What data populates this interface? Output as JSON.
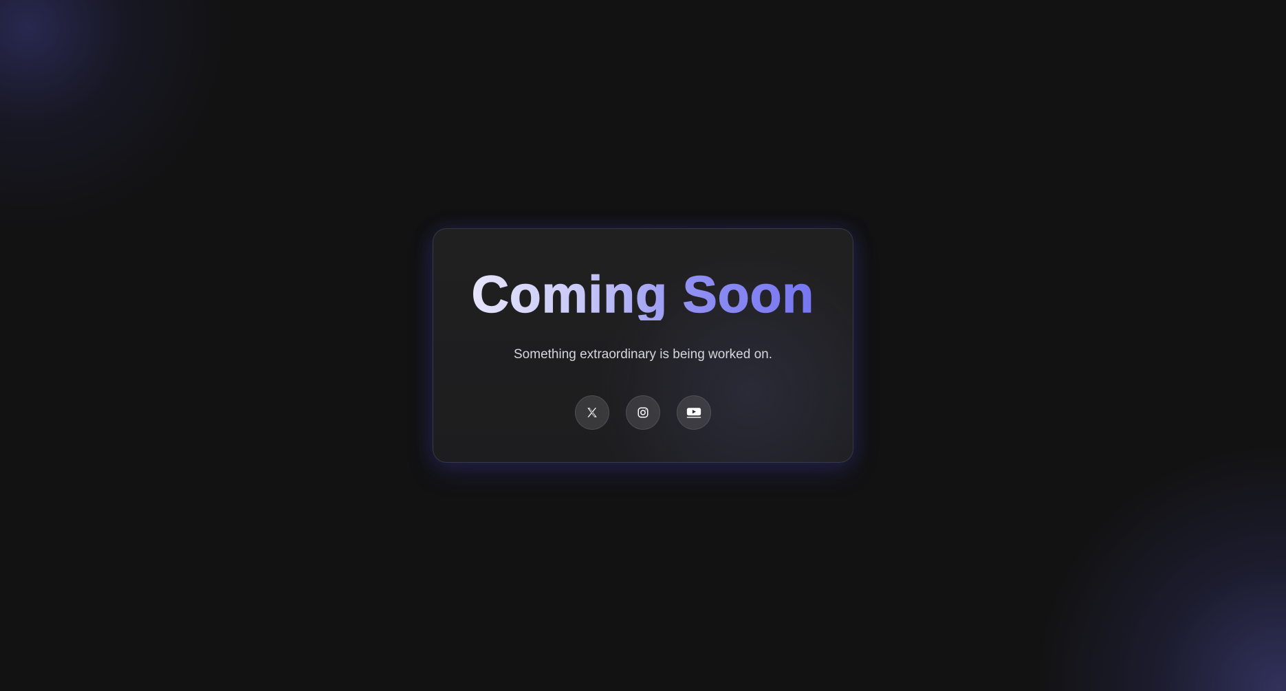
{
  "hero": {
    "title_part1": "Coming",
    "title_part2": "Soon",
    "subtitle": "Something extraordinary is being worked on."
  },
  "socials": [
    {
      "name": "x-twitter",
      "icon": "x-logo-icon"
    },
    {
      "name": "instagram",
      "icon": "instagram-icon"
    },
    {
      "name": "youtube",
      "icon": "youtube-icon"
    }
  ],
  "colors": {
    "background": "#121212",
    "card": "#1f1f1f",
    "accent_start": "#eeeefc",
    "accent_end": "#6e6ef0",
    "subtitle": "#d6d6de"
  }
}
